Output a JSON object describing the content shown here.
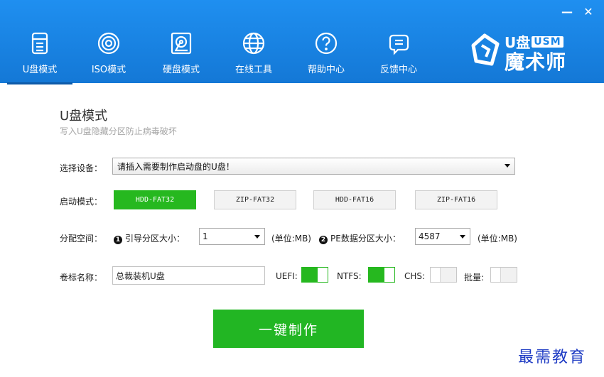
{
  "window": {
    "minimize_label": "—",
    "close_label": "✕"
  },
  "nav": [
    {
      "label": "U盘模式",
      "icon": "usb-drive-icon",
      "active": true
    },
    {
      "label": "ISO模式",
      "icon": "disc-icon",
      "active": false
    },
    {
      "label": "硬盘模式",
      "icon": "hard-disk-icon",
      "active": false
    },
    {
      "label": "在线工具",
      "icon": "globe-icon",
      "active": false
    },
    {
      "label": "帮助中心",
      "icon": "question-icon",
      "active": false
    },
    {
      "label": "反馈中心",
      "icon": "feedback-icon",
      "active": false
    }
  ],
  "brand": {
    "top": "U盘",
    "badge": "USM",
    "main": "魔术师",
    "logo_icon": "usm-logo-icon"
  },
  "page": {
    "title": "U盘模式",
    "subtitle": "写入U盘隐藏分区防止病毒破坏"
  },
  "device": {
    "label": "选择设备：",
    "value": "请插入需要制作启动盘的U盘！"
  },
  "boot_mode": {
    "label": "启动模式：",
    "options": [
      "HDD-FAT32",
      "ZIP-FAT32",
      "HDD-FAT16",
      "ZIP-FAT16"
    ],
    "selected": "HDD-FAT32"
  },
  "partition": {
    "label": "分配空间：",
    "badge1": "1",
    "boot_label": "引导分区大小：",
    "boot_value": "1",
    "unit1": "(单位:MB)",
    "badge2": "2",
    "pe_label": "PE数据分区大小：",
    "pe_value": "4587",
    "unit2": "(单位:MB)"
  },
  "volume": {
    "label": "卷标名称：",
    "value": "总裁装机U盘"
  },
  "toggles": [
    {
      "label": "UEFI:",
      "on": true
    },
    {
      "label": "NTFS:",
      "on": true
    },
    {
      "label": "CHS:",
      "on": false
    },
    {
      "label": "批量:",
      "on": false
    }
  ],
  "action": {
    "label": "一键制作"
  },
  "watermark": "最需教育",
  "colors": {
    "header_blue": "#1a86e8",
    "accent_green": "#26b81f",
    "watermark_blue": "#1f3cc4"
  }
}
